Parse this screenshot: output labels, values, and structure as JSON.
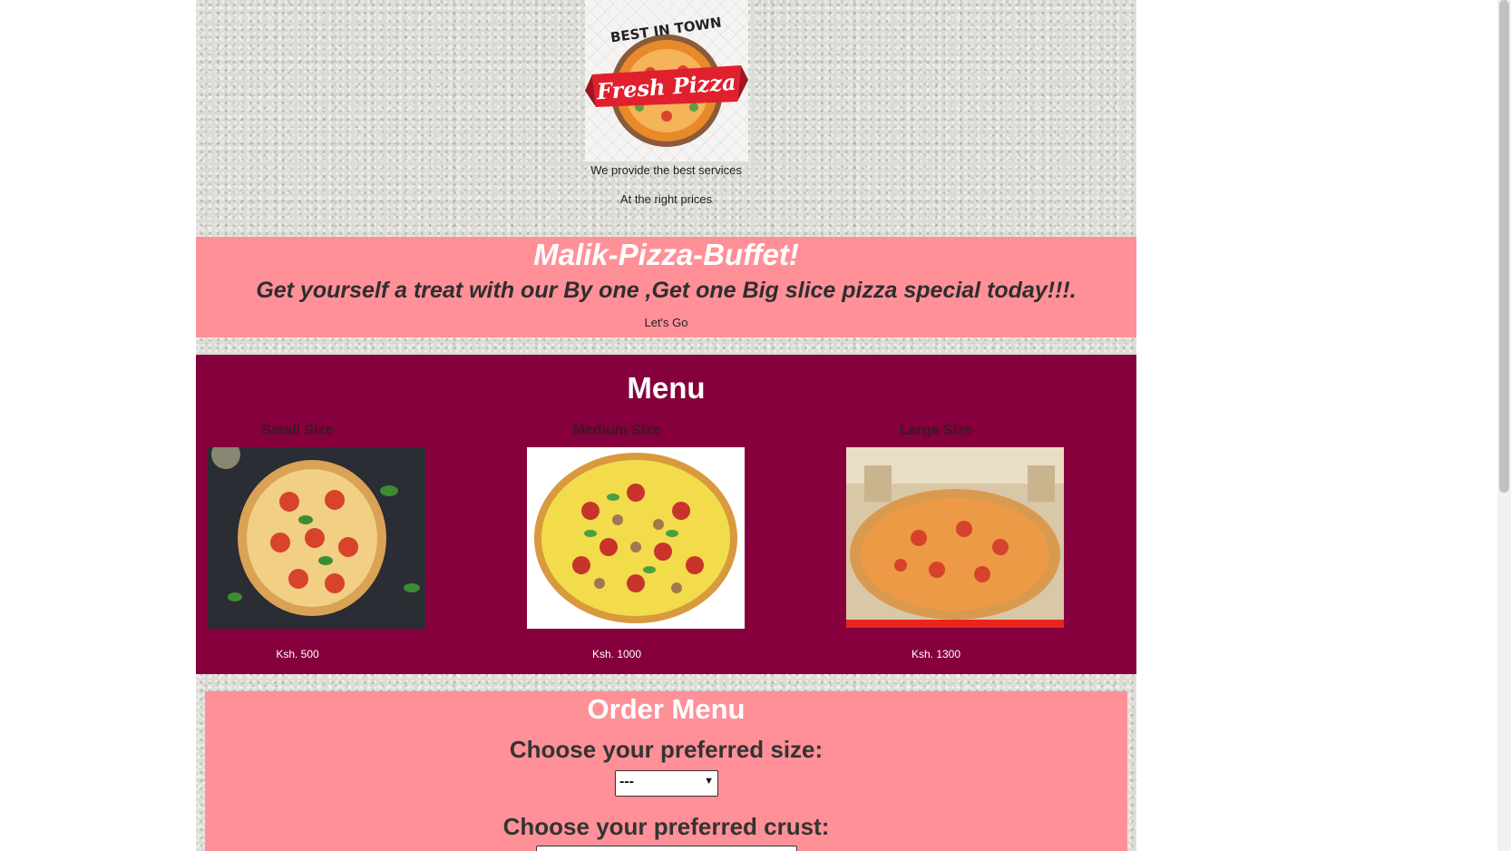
{
  "header": {
    "logo": {
      "top_text": "BEST IN TOWN",
      "banner_text": "Fresh Pizza"
    },
    "tagline_1": "We provide the best services",
    "tagline_2": "At the right prices"
  },
  "hero": {
    "title": "Malik-Pizza-Buffet!",
    "subtitle": "Get yourself a treat with our By one ,Get one Big slice pizza special today!!!.",
    "button_label": "Let's Go"
  },
  "menu": {
    "title": "Menu",
    "items": [
      {
        "size": "Small Size",
        "price": "Ksh. 500",
        "image": "pizza-margherita"
      },
      {
        "size": "Medium Size",
        "price": "Ksh. 1000",
        "image": "pizza-pepperoni-mushroom"
      },
      {
        "size": "Large Size",
        "price": "Ksh. 1300",
        "image": "pizza-in-box"
      }
    ]
  },
  "order": {
    "title": "Order Menu",
    "size_question": "Choose your preferred size:",
    "size_selected": "---",
    "crust_question": "Choose your preferred crust:"
  },
  "colors": {
    "hero_bg": "#ff9098",
    "menu_bg": "#85003c",
    "order_bg": "#ff9098"
  }
}
